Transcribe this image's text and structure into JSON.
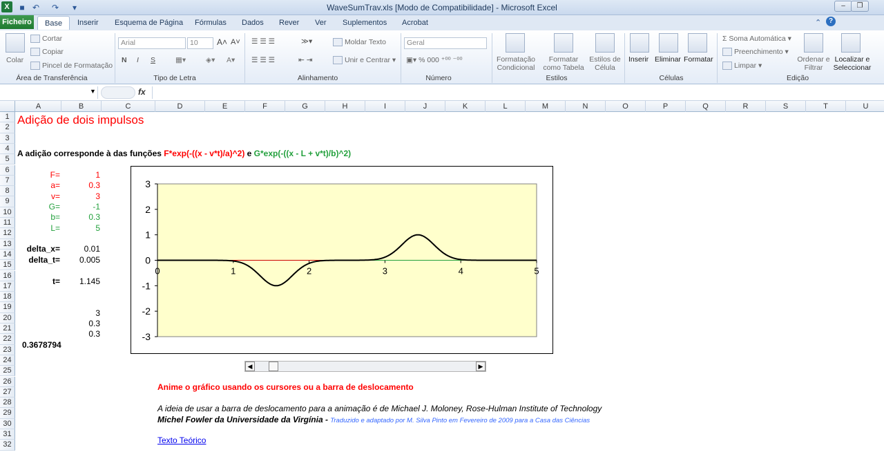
{
  "window": {
    "title": "WaveSumTrav.xls  [Modo de Compatibilidade]  -  Microsoft Excel"
  },
  "tabs": [
    "Ficheiro",
    "Base",
    "Inserir",
    "Esquema de Página",
    "Fórmulas",
    "Dados",
    "Rever",
    "Ver",
    "Suplementos",
    "Acrobat"
  ],
  "ribbon": {
    "clipboard": {
      "paste": "Colar",
      "cut": "Cortar",
      "copy": "Copiar",
      "format_painter": "Pincel de Formatação",
      "label": "Área de Transferência"
    },
    "font": {
      "name": "Arial",
      "size": "10",
      "label": "Tipo de Letra"
    },
    "alignment": {
      "wrap": "Moldar Texto",
      "merge": "Unir e Centrar",
      "label": "Alinhamento"
    },
    "number": {
      "format": "Geral",
      "label": "Número"
    },
    "styles": {
      "conditional": "Formatação Condicional",
      "as_table": "Formatar como Tabela",
      "cell_styles": "Estilos de Célula",
      "label": "Estilos"
    },
    "cells": {
      "insert": "Inserir",
      "delete": "Eliminar",
      "format": "Formatar",
      "label": "Células"
    },
    "editing": {
      "autosum": "Soma Automática",
      "fill": "Preenchimento",
      "clear": "Limpar",
      "sort": "Ordenar e Filtrar",
      "find": "Localizar e Seleccionar",
      "label": "Edição"
    }
  },
  "formula_bar": {
    "fx": "fx",
    "value": ""
  },
  "columns": [
    "A",
    "B",
    "C",
    "D",
    "E",
    "F",
    "G",
    "H",
    "I",
    "J",
    "K",
    "L",
    "M",
    "N",
    "O",
    "P",
    "Q",
    "R",
    "S",
    "T",
    "U"
  ],
  "rows": [
    "1",
    "2",
    "3",
    "4",
    "5",
    "6",
    "7",
    "8",
    "9",
    "10",
    "11",
    "12",
    "13",
    "14",
    "15",
    "16",
    "17",
    "18",
    "19",
    "20",
    "21",
    "22",
    "23",
    "24",
    "25",
    "26",
    "27",
    "28",
    "29",
    "30",
    "31",
    "32"
  ],
  "sheet": {
    "title": "Adição de dois impulsos",
    "desc_prefix": "A adição corresponde à das funções ",
    "desc_f": "F*exp(-((x - v*t)/a)^2)",
    "desc_mid": " e ",
    "desc_g": "G*exp(-((x - L + v*t)/b)^2)",
    "params": [
      {
        "label": "F=",
        "value": "1",
        "color": "red"
      },
      {
        "label": "a=",
        "value": "0.3",
        "color": "red"
      },
      {
        "label": "v=",
        "value": "3",
        "color": "red"
      },
      {
        "label": "G=",
        "value": "-1",
        "color": "green"
      },
      {
        "label": "b=",
        "value": "0.3",
        "color": "green"
      },
      {
        "label": "L=",
        "value": "5",
        "color": "green"
      }
    ],
    "delta_x_label": "delta_x=",
    "delta_x": "0.01",
    "delta_t_label": "delta_t=",
    "delta_t": "0.005",
    "t_label": "t=",
    "t": "1.145",
    "b19": "3",
    "b20": "0.3",
    "b21": "0.3",
    "a22": "0.3678794",
    "animate": "Anime o gráfico usando os cursores ou a barra de deslocamento",
    "credit1": "A ideia de usar a barra de deslocamento para a animação é de Michael J. Moloney, Rose-Hulman Institute of Technology",
    "credit2": "Michel Fowler da Universidade da Virgínia - ",
    "credit3": "Traduzido e adaptado por M. Silva Pinto em Fevereiro de 2009 para a Casa das Ciências",
    "link": "Texto Teórico"
  },
  "chart_data": {
    "type": "line",
    "xlim": [
      0,
      5
    ],
    "ylim": [
      -3,
      3
    ],
    "xticks": [
      "0",
      "1",
      "2",
      "3",
      "4",
      "5"
    ],
    "yticks": [
      "3",
      "2",
      "1",
      "0",
      "-1",
      "-2",
      "-3"
    ],
    "params": {
      "F": 1,
      "a": 0.3,
      "v": 3,
      "G": -1,
      "b": 0.3,
      "L": 5,
      "t": 1.145
    },
    "series": [
      {
        "color": "#cc0000"
      },
      {
        "color": "#22a03c"
      },
      {
        "color": "#000000"
      }
    ],
    "plot_bg": "#ffffcc"
  }
}
